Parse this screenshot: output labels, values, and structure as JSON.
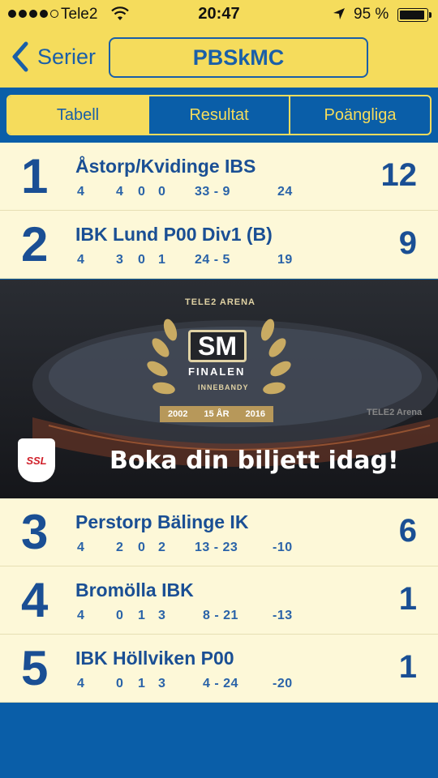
{
  "status_bar": {
    "carrier": "Tele2",
    "time": "20:47",
    "battery": "95 %",
    "battery_level": 0.95,
    "signal_bars": 4
  },
  "nav": {
    "back_label": "Serier",
    "title": "PBSkMC"
  },
  "tabs": [
    {
      "label": "Tabell",
      "active": true
    },
    {
      "label": "Resultat",
      "active": false
    },
    {
      "label": "Poängliga",
      "active": false
    }
  ],
  "standings": [
    {
      "rank": "1",
      "team": "Åstorp/Kvidinge IBS",
      "played": "4",
      "w": "4",
      "d": "0",
      "l": "0",
      "goals": "33 - 9",
      "diff": "24",
      "points": "12"
    },
    {
      "rank": "2",
      "team": "IBK Lund P00 Div1 (B)",
      "played": "4",
      "w": "3",
      "d": "0",
      "l": "1",
      "goals": "24 - 5",
      "diff": "19",
      "points": "9"
    },
    {
      "rank": "3",
      "team": "Perstorp Bälinge IK",
      "played": "4",
      "w": "2",
      "d": "0",
      "l": "2",
      "goals": "13 - 23",
      "diff": "-10",
      "points": "6"
    },
    {
      "rank": "4",
      "team": "Bromölla IBK",
      "played": "4",
      "w": "0",
      "d": "1",
      "l": "3",
      "goals": "8 - 21",
      "diff": "-13",
      "points": "1"
    },
    {
      "rank": "5",
      "team": "IBK Höllviken P00",
      "played": "4",
      "w": "0",
      "d": "1",
      "l": "3",
      "goals": "4 - 24",
      "diff": "-20",
      "points": "1"
    }
  ],
  "ad": {
    "arena": "TELE2 ARENA",
    "sm": "SM",
    "finalen": "FINALEN",
    "innebandy": "INNEBANDY",
    "year_start": "2002",
    "anniversary": "15 ÅR",
    "year_end": "2016",
    "tagline": "Boka din biljett idag!",
    "logo": "SSL",
    "venue_sign": "TELE2 Arena"
  },
  "colors": {
    "yellow": "#f5dc5c",
    "blue": "#0a5ea8",
    "text_blue": "#1a4f94",
    "row_bg": "#fdf8d8"
  }
}
